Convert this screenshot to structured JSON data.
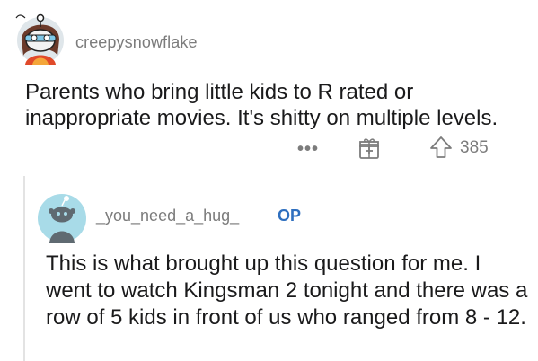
{
  "comment1": {
    "username": "creepysnowflake",
    "body": "Parents who bring little kids to R rated or inappropriate movies. It's shitty on multiple levels.",
    "more_label": "•••",
    "gift_icon": "gift-icon",
    "upvote_icon": "upvote-arrow-icon",
    "score": "385"
  },
  "comment2": {
    "username": "_you_need_a_hug_",
    "op_label": "OP",
    "body": "This is what brought up this question for me. I went to watch Kingsman 2 tonight and there was a row of 5 kids in front of us who ranged from 8 - 12."
  },
  "colors": {
    "text": "#1a1a1b",
    "meta": "#7c7c7c",
    "op": "#2e6fbf",
    "thread_line": "#e3e3e3"
  }
}
